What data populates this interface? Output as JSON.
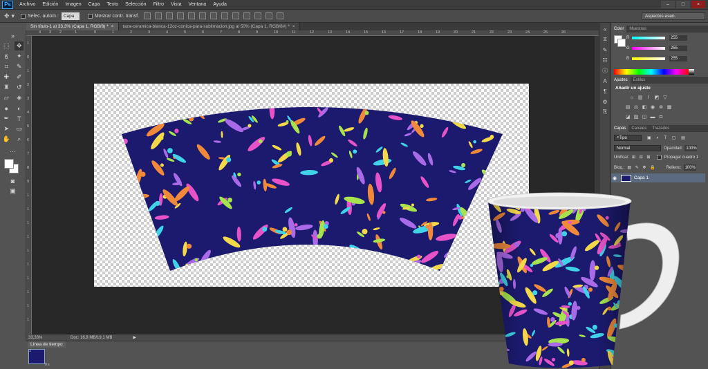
{
  "menubar": {
    "logo": "Ps",
    "items": [
      "Archivo",
      "Edición",
      "Imagen",
      "Capa",
      "Texto",
      "Selección",
      "Filtro",
      "Vista",
      "Ventana",
      "Ayuda"
    ],
    "minimize": "–",
    "maximize": "□",
    "close": "×"
  },
  "options": {
    "auto_select_label": "Selec. autom.:",
    "auto_select_value": "Capa",
    "transform_label": "Mostrar contr. transf.",
    "workspace": "Aspectos esen."
  },
  "tabs": [
    {
      "label": "Sin título-1 al 33,3% (Capa 1, RGB/8) *",
      "close": "×"
    },
    {
      "label": "taza-ceramica-blanca-12oz-conica-para-sublimacion.jpg al 50% (Capa 1, RGB/8#) *",
      "close": "×"
    }
  ],
  "ruler": {
    "top": [
      "4",
      "3",
      "2",
      "1",
      "0",
      "1",
      "2",
      "3",
      "4",
      "5",
      "6",
      "7",
      "8",
      "9",
      "10",
      "11",
      "12",
      "13",
      "14",
      "15",
      "16",
      "17",
      "18",
      "19",
      "20",
      "21",
      "22",
      "23",
      "24",
      "25",
      "26"
    ],
    "left": [
      "1",
      "0",
      "1",
      "2",
      "3",
      "4",
      "5",
      "6",
      "7",
      "8",
      "9",
      "1",
      "1",
      "1",
      "1",
      "1",
      "1",
      "1",
      "1",
      "1",
      "1"
    ]
  },
  "status": {
    "zoom": "33,33%",
    "doc": "Doc: 16,8 MB/19,1 MB",
    "arrow": "▶"
  },
  "timeline": {
    "tab": "Línea de tiempo",
    "frame_number": "1",
    "frame_time": "0 s"
  },
  "panels": {
    "color": {
      "tabs": [
        "Color",
        "Muestras"
      ],
      "r_label": "R",
      "r": "255",
      "g_label": "G",
      "g": "255",
      "b_label": "B",
      "b": "255"
    },
    "adjustments": {
      "tabs": [
        "Ajustes",
        "Estilos"
      ],
      "title": "Añadir un ajuste"
    },
    "layers": {
      "tabs": [
        "Capas",
        "Canales",
        "Trazados"
      ],
      "kind_filter": "Tipo",
      "blend_mode": "Normal",
      "opacity_label": "Opacidad:",
      "opacity": "100%",
      "unify_label": "Unificar:",
      "propagate_label": "Propagar cuadro 1",
      "lock_label": "Bloq.:",
      "fill_label": "Relleno:",
      "fill": "100%",
      "layer_name": "Capa 1"
    }
  },
  "colors": {
    "pattern_bg": "#1c1a6e",
    "leaf_pink": "#e653c9",
    "leaf_cyan": "#3fd2e8",
    "leaf_yellow": "#f3d94a",
    "leaf_purple": "#a86ae6",
    "leaf_lime": "#a7e34f",
    "leaf_orange": "#f08a3a"
  }
}
